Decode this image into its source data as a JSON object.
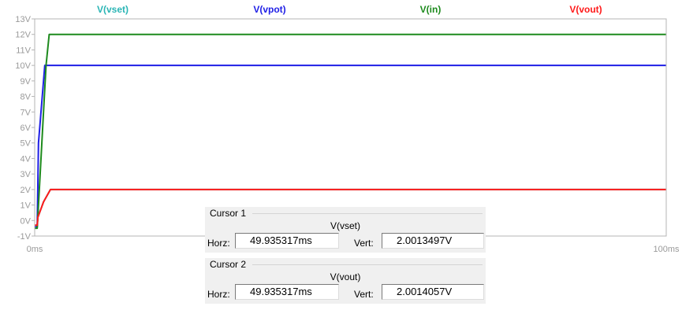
{
  "plot": {
    "y_ticks": [
      "13V",
      "12V",
      "11V",
      "10V",
      "9V",
      "8V",
      "7V",
      "6V",
      "5V",
      "4V",
      "3V",
      "2V",
      "1V",
      "0V",
      "-1V"
    ],
    "x_start_label": "0ms",
    "x_end_label": "100ms"
  },
  "chart_data": {
    "type": "line",
    "xlabel": "",
    "ylabel": "",
    "x_unit": "ms",
    "y_unit": "V",
    "xlim": [
      0,
      100
    ],
    "ylim": [
      -1,
      13
    ],
    "grid": false,
    "legend_placement": "top",
    "series": [
      {
        "name": "V(vset)",
        "color": "#2ab5b5",
        "x": [
          0,
          0.4,
          0.5,
          1.4,
          2.5,
          100
        ],
        "y": [
          -0.3,
          -0.3,
          0.2,
          1.2,
          2.0,
          2.0
        ]
      },
      {
        "name": "V(vpot)",
        "color": "#1f1fe6",
        "x": [
          0,
          0.4,
          0.6,
          1.6,
          2.0,
          100
        ],
        "y": [
          -0.4,
          -0.4,
          5.0,
          10.0,
          10.0,
          10.0
        ]
      },
      {
        "name": "V(in)",
        "color": "#1d8a1d",
        "x": [
          0,
          0.4,
          1.8,
          2.3,
          100
        ],
        "y": [
          -0.5,
          -0.5,
          10.0,
          12.0,
          12.0
        ]
      },
      {
        "name": "V(vout)",
        "color": "#ff1a1a",
        "x": [
          0,
          0.4,
          0.5,
          1.4,
          2.5,
          100
        ],
        "y": [
          -0.3,
          -0.3,
          0.2,
          1.2,
          2.0,
          2.0
        ]
      }
    ]
  },
  "cursors": [
    {
      "title": "Cursor 1",
      "trace": "V(vset)",
      "horz_label": "Horz:",
      "horz": "49.935317ms",
      "vert_label": "Vert:",
      "vert": "2.0013497V"
    },
    {
      "title": "Cursor 2",
      "trace": "V(vout)",
      "horz_label": "Horz:",
      "horz": "49.935317ms",
      "vert_label": "Vert:",
      "vert": "2.0014057V"
    }
  ]
}
